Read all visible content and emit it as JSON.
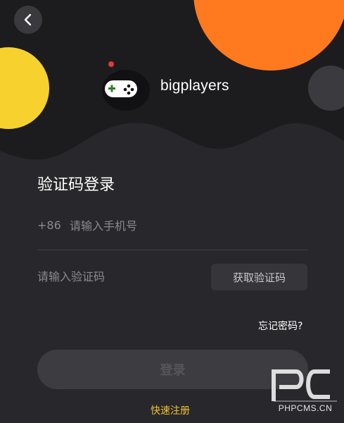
{
  "colors": {
    "background": "#28282c",
    "header_background": "#1c1c1f",
    "accent_orange": "#ff7a1e",
    "accent_yellow": "#f7d12d",
    "link_yellow": "#f2c230"
  },
  "nav": {
    "back_icon": "chevron-left-icon"
  },
  "brand": {
    "name": "bigplayers",
    "logo_icon": "robot-gamepad-logo"
  },
  "form": {
    "title": "验证码登录",
    "country_code": "+86",
    "phone_placeholder": "请输入手机号",
    "code_placeholder": "请输入验证码",
    "get_code_label": "获取验证码",
    "forgot_label": "忘记密码?",
    "login_label": "登录",
    "register_label": "快速注册"
  },
  "watermark": {
    "logo_text": "PC",
    "site": "PHPCMS.CN"
  }
}
